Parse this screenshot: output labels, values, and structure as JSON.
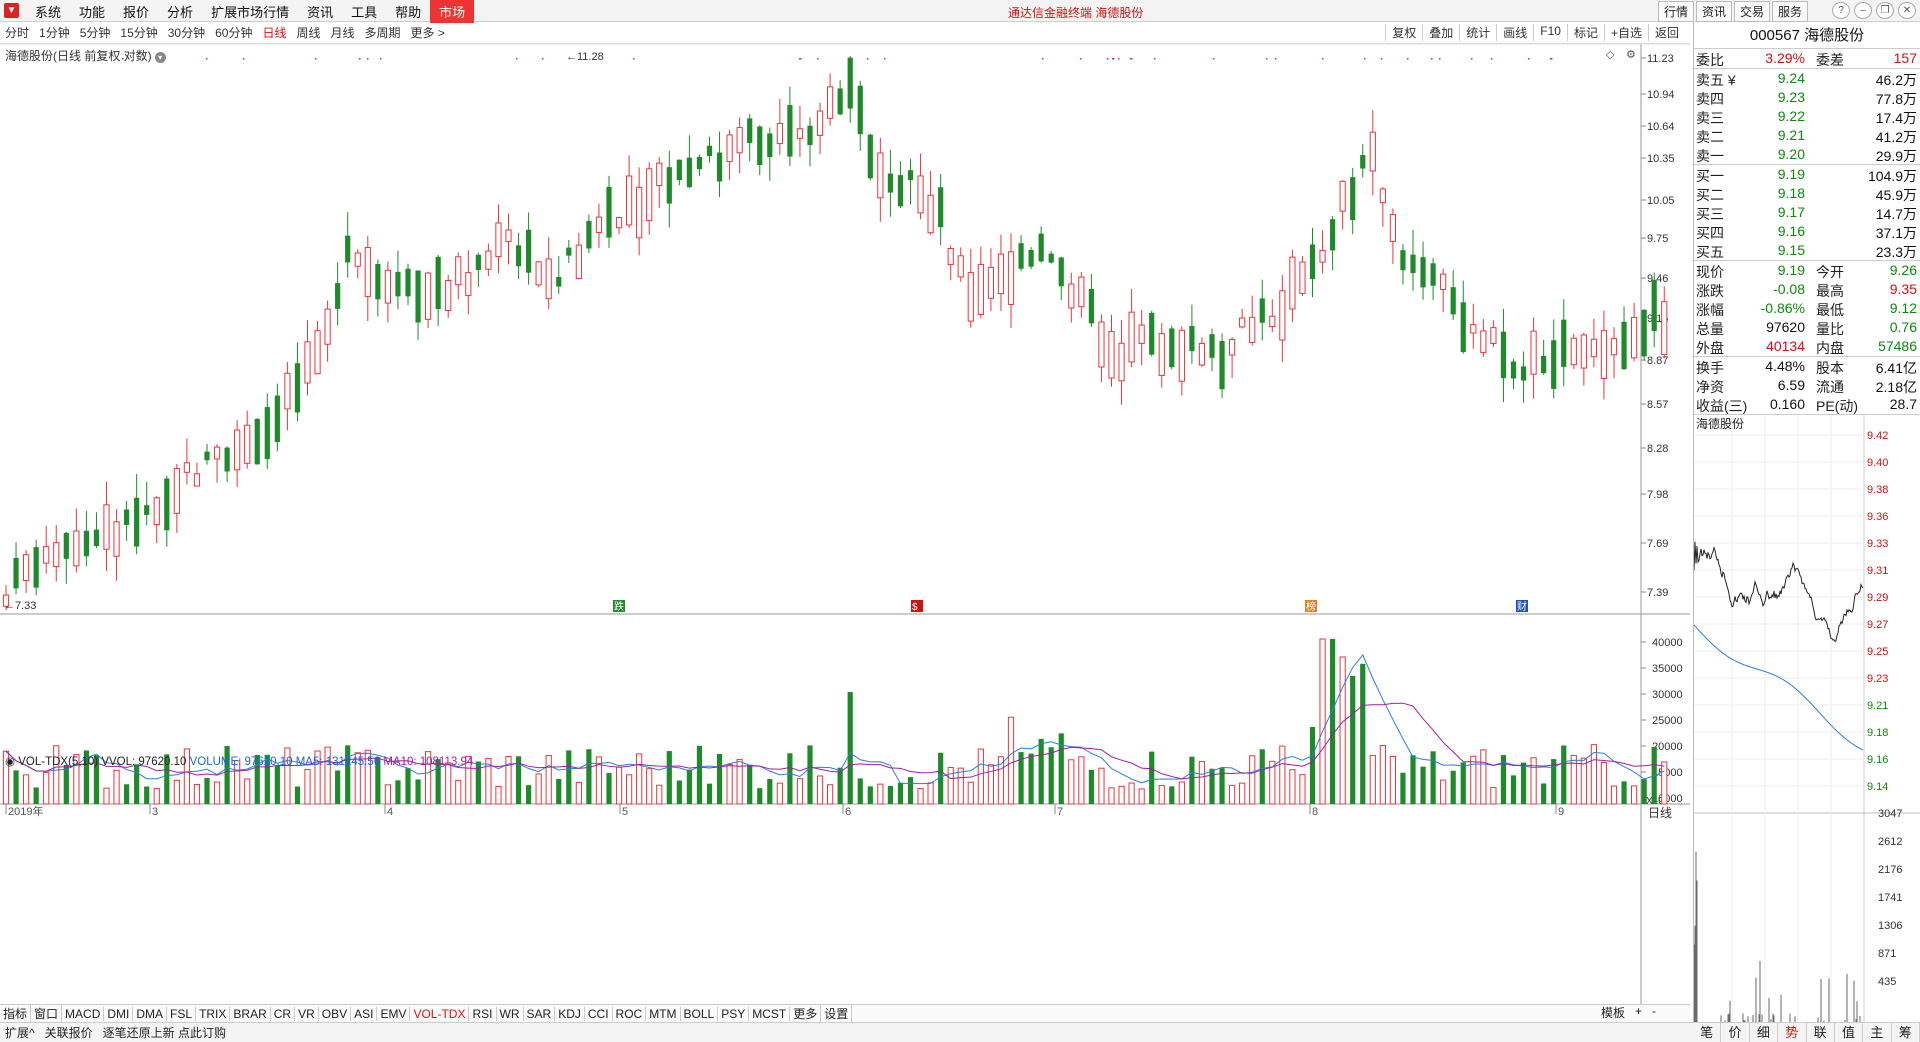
{
  "menubar": {
    "items": [
      "系统",
      "功能",
      "报价",
      "分析",
      "扩展市场行情",
      "资讯",
      "工具",
      "帮助",
      "市场"
    ],
    "active_index": 8,
    "title": "通达信金融终端  海德股份",
    "right_buttons": [
      "行情",
      "资讯",
      "交易",
      "服务"
    ]
  },
  "periodbar": {
    "items": [
      "分时",
      "1分钟",
      "5分钟",
      "15分钟",
      "30分钟",
      "60分钟",
      "日线",
      "周线",
      "月线",
      "多周期",
      "更多 >"
    ],
    "active_index": 6
  },
  "toolbar_right": [
    "复权",
    "叠加",
    "统计",
    "画线",
    "F10",
    "标记",
    "+自选",
    "返回"
  ],
  "chart": {
    "title": "海德股份(日线 前复权 对数)",
    "y_ticks": [
      "11.23",
      "10.94",
      "10.64",
      "10.35",
      "10.05",
      "9.75",
      "9.46",
      "9.16",
      "8.87",
      "8.57",
      "8.28",
      "7.98",
      "7.69",
      "7.39"
    ],
    "high_label": "11.28",
    "low_label": "7.33",
    "x_labels": [
      "2019年",
      "3",
      "4",
      "5",
      "6",
      "7",
      "8",
      "9"
    ],
    "markers": [
      "跌",
      "$",
      "榜",
      "财"
    ]
  },
  "volume": {
    "title": "VOL-TDX(5,10) VVOL: 97620.10",
    "volume_label": "VOLUME: 97620.10",
    "ma5_label": "MA5: 131245.56",
    "ma10_label": "MA10: 108113.94",
    "y_ticks": [
      "40000",
      "35000",
      "30000",
      "25000",
      "20000",
      "15000",
      "10000"
    ],
    "unit": "X10"
  },
  "indicator_bar": {
    "items": [
      "指标",
      "窗口",
      "MACD",
      "DMI",
      "DMA",
      "FSL",
      "TRIX",
      "BRAR",
      "CR",
      "VR",
      "OBV",
      "ASI",
      "EMV",
      "VOL-TDX",
      "RSI",
      "WR",
      "SAR",
      "KDJ",
      "CCI",
      "ROC",
      "MTM",
      "BOLL",
      "PSY",
      "MCST",
      "更多",
      "设置"
    ],
    "active_index": 13,
    "right": [
      "模板",
      "+",
      "-"
    ]
  },
  "statusbar": [
    "扩展^",
    "关联报价",
    "逐笔还原上新 点此订购"
  ],
  "quote": {
    "code": "000567",
    "name": "海德股份",
    "weibi_label": "委比",
    "weibi": "3.29%",
    "weicha_label": "委差",
    "weicha": "157",
    "asks": [
      {
        "label": "卖五 ¥",
        "price": "9.24",
        "vol": "46.2万"
      },
      {
        "label": "卖四",
        "price": "9.23",
        "vol": "77.8万"
      },
      {
        "label": "卖三",
        "price": "9.22",
        "vol": "17.4万"
      },
      {
        "label": "卖二",
        "price": "9.21",
        "vol": "41.2万"
      },
      {
        "label": "卖一",
        "price": "9.20",
        "vol": "29.9万"
      }
    ],
    "bids": [
      {
        "label": "买一",
        "price": "9.19",
        "vol": "104.9万"
      },
      {
        "label": "买二",
        "price": "9.18",
        "vol": "45.9万"
      },
      {
        "label": "买三",
        "price": "9.17",
        "vol": "14.7万"
      },
      {
        "label": "买四",
        "price": "9.16",
        "vol": "37.1万"
      },
      {
        "label": "买五",
        "price": "9.15",
        "vol": "23.3万"
      }
    ],
    "stats": [
      {
        "l1": "现价",
        "v1": "9.19",
        "c1": "g",
        "l2": "今开",
        "v2": "9.26",
        "c2": "g"
      },
      {
        "l1": "涨跌",
        "v1": "-0.08",
        "c1": "g",
        "l2": "最高",
        "v2": "9.35",
        "c2": "r"
      },
      {
        "l1": "涨幅",
        "v1": "-0.86%",
        "c1": "g",
        "l2": "最低",
        "v2": "9.12",
        "c2": "g"
      },
      {
        "l1": "总量",
        "v1": "97620",
        "c1": "k",
        "l2": "量比",
        "v2": "0.76",
        "c2": "g"
      },
      {
        "l1": "外盘",
        "v1": "40134",
        "c1": "r",
        "l2": "内盘",
        "v2": "57486",
        "c2": "g"
      }
    ],
    "stats2": [
      {
        "l1": "换手",
        "v1": "4.48%",
        "l2": "股本",
        "v2": "6.41亿"
      },
      {
        "l1": "净资",
        "v1": "6.59",
        "l2": "流通",
        "v2": "2.18亿"
      },
      {
        "l1": "收益(三)",
        "v1": "0.160",
        "l2": "PE(动)",
        "v2": "28.7"
      }
    ]
  },
  "mini_chart": {
    "title": "海德股份",
    "price_ticks": [
      "9.42",
      "9.40",
      "9.38",
      "9.36",
      "9.33",
      "9.31",
      "9.29",
      "9.27",
      "9.25",
      "9.23",
      "9.21",
      "9.18",
      "9.16",
      "9.14"
    ],
    "vol_ticks": [
      "3047",
      "2612",
      "2176",
      "1741",
      "1306",
      "871",
      "435"
    ]
  },
  "rp_tabs": [
    "笔",
    "价",
    "细",
    "势",
    "联",
    "值",
    "主",
    "筹"
  ],
  "rp_tabs_active": 3,
  "colors": {
    "up": "#e8363b",
    "down": "#1f8a2a",
    "ma5": "#2a7fd6",
    "ma10": "#9b1fa3"
  }
}
